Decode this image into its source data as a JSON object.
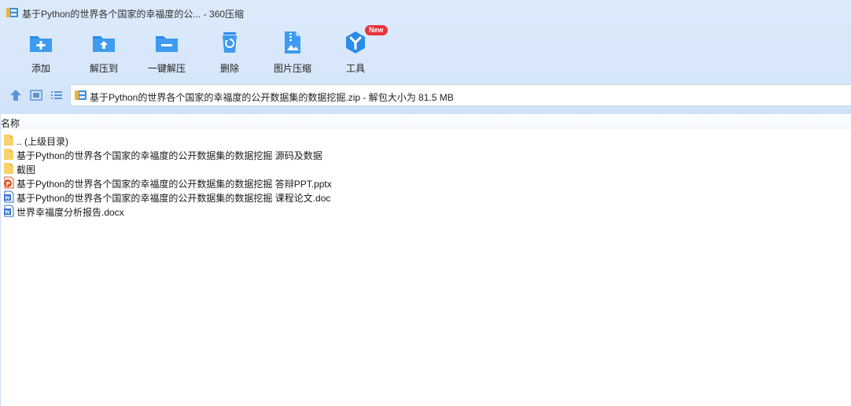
{
  "window": {
    "title": "基于Python的世界各个国家的幸福度的公... - 360压缩"
  },
  "toolbar": {
    "items": [
      {
        "label": "添加",
        "icon": "add-folder-icon"
      },
      {
        "label": "解压到",
        "icon": "extract-to-icon"
      },
      {
        "label": "一键解压",
        "icon": "one-click-extract-icon"
      },
      {
        "label": "删除",
        "icon": "trash-icon"
      },
      {
        "label": "图片压缩",
        "icon": "image-compress-icon"
      },
      {
        "label": "工具",
        "icon": "tools-icon",
        "badge": "New"
      }
    ]
  },
  "navbar": {
    "address": "基于Python的世界各个国家的幸福度的公开数据集的数据挖掘.zip - 解包大小为 81.5 MB"
  },
  "list": {
    "column_name": "名称",
    "items": [
      {
        "name": ".. (上级目录)",
        "type": "folder-up"
      },
      {
        "name": "基于Python的世界各个国家的幸福度的公开数据集的数据挖掘 源码及数据",
        "type": "folder"
      },
      {
        "name": "截图",
        "type": "folder"
      },
      {
        "name": "基于Python的世界各个国家的幸福度的公开数据集的数据挖掘 答辩PPT.pptx",
        "type": "pptx"
      },
      {
        "name": "基于Python的世界各个国家的幸福度的公开数据集的数据挖掘 课程论文.doc",
        "type": "doc"
      },
      {
        "name": "世界幸福度分析报告.docx",
        "type": "doc"
      }
    ]
  },
  "colors": {
    "accent": "#2a8ce6",
    "toolbar_bg": "#d9e9fb",
    "badge": "#e8323c",
    "folder": "#f7d26a",
    "pptx": "#e0552b",
    "doc": "#2f6fc9"
  }
}
